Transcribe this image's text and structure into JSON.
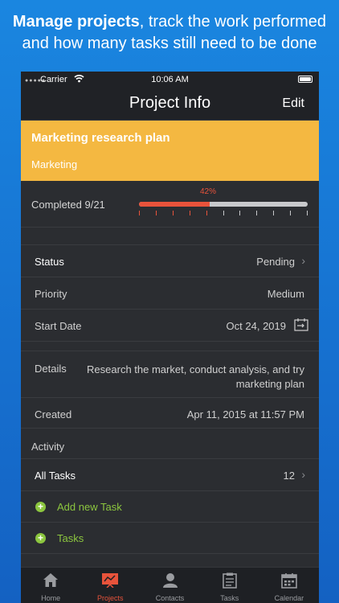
{
  "promo": {
    "line1_bold": "Manage projects",
    "line1_rest": ", track the work performed",
    "line2": "and how many tasks still need to be done"
  },
  "status_bar": {
    "carrier": "Carrier",
    "time": "10:06 AM"
  },
  "nav": {
    "title": "Project Info",
    "edit_label": "Edit"
  },
  "project": {
    "name": "Marketing research plan",
    "category": "Marketing",
    "accent_color": "#f4b841"
  },
  "progress": {
    "label": "Completed 9/21",
    "percent_label": "42%",
    "fraction": 0.42,
    "bar_color": "#e8533b"
  },
  "fields": {
    "status": {
      "key": "Status",
      "value": "Pending"
    },
    "priority": {
      "key": "Priority",
      "value": "Medium"
    },
    "start_date": {
      "key": "Start Date",
      "value": "Oct 24, 2019"
    },
    "details": {
      "key": "Details",
      "value": "Research the market, conduct analysis, and try marketing plan"
    },
    "created": {
      "key": "Created",
      "value": "Apr 11, 2015 at 11:57 PM"
    }
  },
  "activity": {
    "section_label": "Activity",
    "all_tasks": {
      "label": "All Tasks",
      "count": "12"
    },
    "add_task_label": "Add new Task",
    "tasks_label": "Tasks",
    "add_color": "#8cc63f"
  },
  "tabs": [
    {
      "label": "Home",
      "icon": "home-icon"
    },
    {
      "label": "Projects",
      "icon": "projects-icon",
      "active": true
    },
    {
      "label": "Contacts",
      "icon": "contacts-icon"
    },
    {
      "label": "Tasks",
      "icon": "tasks-icon"
    },
    {
      "label": "Calendar",
      "icon": "calendar-icon"
    }
  ]
}
